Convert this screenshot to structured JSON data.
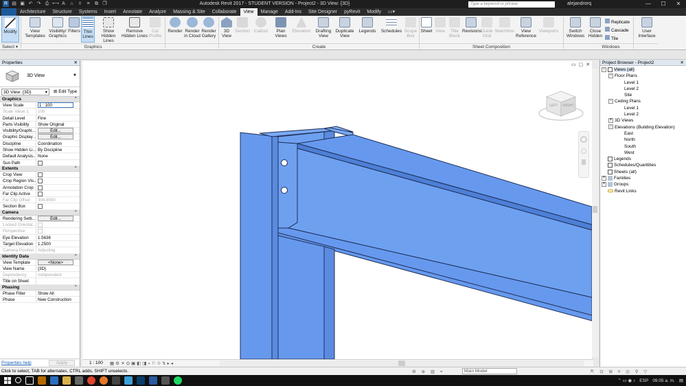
{
  "titlebar": {
    "title": "Autodesk Revit 2017 - STUDENT VERSION -    Project2 - 3D View: {3D}",
    "search_placeholder": "Type a keyword or phrase",
    "user": "alejandrorq",
    "minimize": "—",
    "maximize": "☐",
    "close": "✕"
  },
  "tabs": {
    "file": "",
    "items": [
      "Architecture",
      "Structure",
      "Systems",
      "Insert",
      "Annotate",
      "Analyze",
      "Massing & Site",
      "Collaborate",
      "View",
      "Manage",
      "Add-Ins",
      "Site Designer",
      "pyRevit",
      "Modify"
    ],
    "active": "View"
  },
  "ribbon": {
    "buttons": [
      {
        "label": "Modify",
        "icon": "arrow-cursor-icon"
      },
      {
        "label": "View Templates",
        "icon": "view-templates-icon"
      },
      {
        "label": "Visibility/ Graphics",
        "icon": "visibility-graphics-icon"
      },
      {
        "label": "Filters",
        "icon": "filters-icon"
      },
      {
        "label": "Thin Lines",
        "icon": "thin-lines-icon"
      },
      {
        "label": "Show Hidden Lines",
        "icon": "show-hidden-lines-icon"
      },
      {
        "label": "Remove Hidden Lines",
        "icon": "remove-hidden-lines-icon"
      },
      {
        "label": "Cut Profile",
        "icon": "cut-profile-icon"
      },
      {
        "label": "Render",
        "icon": "render-teapot-icon"
      },
      {
        "label": "Render in Cloud",
        "icon": "render-cloud-icon"
      },
      {
        "label": "Render Gallery",
        "icon": "render-gallery-icon"
      },
      {
        "label": "3D View",
        "icon": "house-3d-icon"
      },
      {
        "label": "Section",
        "icon": "section-icon"
      },
      {
        "label": "Callout",
        "icon": "callout-icon"
      },
      {
        "label": "Plan Views",
        "icon": "plan-views-icon"
      },
      {
        "label": "Elevation",
        "icon": "elevation-icon"
      },
      {
        "label": "Drafting View",
        "icon": "drafting-view-icon"
      },
      {
        "label": "Duplicate View",
        "icon": "duplicate-view-icon"
      },
      {
        "label": "Legends",
        "icon": "legends-icon"
      },
      {
        "label": "Schedules",
        "icon": "schedules-icon"
      },
      {
        "label": "Scope Box",
        "icon": "scope-box-icon"
      },
      {
        "label": "Sheet",
        "icon": "sheet-icon"
      },
      {
        "label": "View",
        "icon": "view-on-sheet-icon"
      },
      {
        "label": "Title Block",
        "icon": "title-block-icon"
      },
      {
        "label": "Revisions",
        "icon": "revisions-icon"
      },
      {
        "label": "Guide Grid",
        "icon": "guide-grid-icon"
      },
      {
        "label": "Matchline",
        "icon": "matchline-icon"
      },
      {
        "label": "View Reference",
        "icon": "view-reference-icon"
      },
      {
        "label": "Viewports",
        "icon": "viewports-icon"
      },
      {
        "label": "Switch Windows",
        "icon": "switch-windows-icon"
      },
      {
        "label": "Close Hidden",
        "icon": "close-hidden-icon"
      },
      {
        "label": "Replicate",
        "icon": "replicate-icon"
      },
      {
        "label": "Cascade",
        "icon": "cascade-icon"
      },
      {
        "label": "Tile",
        "icon": "tile-icon"
      },
      {
        "label": "User Interface",
        "icon": "user-interface-icon"
      }
    ],
    "panels": [
      "Select ▾",
      "Graphics",
      "Create",
      "Sheet Composition",
      "Windows"
    ]
  },
  "properties": {
    "header": "Properties",
    "type_name": "3D View",
    "view_selector": "3D View: {3D}",
    "edit_type": "Edit Type",
    "groups": {
      "graphics": "Graphics",
      "extents": "Extents",
      "camera": "Camera",
      "identity": "Identity Data",
      "phasing": "Phasing"
    },
    "rows": {
      "view_scale": {
        "k": "View Scale",
        "v": "1 : 100"
      },
      "scale_value": {
        "k": "Scale Value   1:",
        "v": "100"
      },
      "detail_level": {
        "k": "Detail Level",
        "v": "Fine"
      },
      "parts_visibility": {
        "k": "Parts Visibility",
        "v": "Show Original"
      },
      "vis_graphics": {
        "k": "Visibility/Graphi...",
        "v": "Edit..."
      },
      "graphic_display": {
        "k": "Graphic Display ...",
        "v": "Edit..."
      },
      "discipline": {
        "k": "Discipline",
        "v": "Coordination"
      },
      "show_hidden": {
        "k": "Show Hidden Li...",
        "v": "By Discipline"
      },
      "default_analysis": {
        "k": "Default Analysis...",
        "v": "None"
      },
      "sun_path": {
        "k": "Sun Path",
        "v": ""
      },
      "crop_view": {
        "k": "Crop View",
        "v": ""
      },
      "crop_region": {
        "k": "Crop Region Vis...",
        "v": ""
      },
      "annotation_crop": {
        "k": "Annotation Crop",
        "v": ""
      },
      "far_clip_active": {
        "k": "Far Clip Active",
        "v": ""
      },
      "far_clip_offset": {
        "k": "Far Clip Offset",
        "v": "304.8000"
      },
      "section_box": {
        "k": "Section Box",
        "v": ""
      },
      "rendering_settings": {
        "k": "Rendering Setti...",
        "v": "Edit..."
      },
      "locked_orient": {
        "k": "Locked Orientat...",
        "v": ""
      },
      "perspective": {
        "k": "Perspective",
        "v": ""
      },
      "eye_elevation": {
        "k": "Eye Elevation",
        "v": "1.5636"
      },
      "target_elevation": {
        "k": "Target Elevation",
        "v": "1.2500"
      },
      "camera_position": {
        "k": "Camera Position",
        "v": "Adjusting"
      },
      "view_template": {
        "k": "View Template",
        "v": "<None>"
      },
      "view_name": {
        "k": "View Name",
        "v": "{3D}"
      },
      "dependency": {
        "k": "Dependency",
        "v": "Independent"
      },
      "title_on_sheet": {
        "k": "Title on Sheet",
        "v": ""
      },
      "phase_filter": {
        "k": "Phase Filter",
        "v": "Show All"
      },
      "phase": {
        "k": "Phase",
        "v": "New Construction"
      }
    },
    "help": "Properties help",
    "apply": "Apply"
  },
  "viewport": {
    "scale": "1 : 100",
    "viewcube_left": "LEFT",
    "viewcube_right": "RIGHT",
    "beam_color": "#6699ee"
  },
  "browser": {
    "header": "Project Browser - Project2",
    "tree": {
      "views": "Views (all)",
      "floor_plans": "Floor Plans",
      "level1": "Level 1",
      "level2": "Level 2",
      "site": "Site",
      "ceiling_plans": "Ceiling Plans",
      "c_level1": "Level 1",
      "c_level2": "Level 2",
      "views3d": "3D Views",
      "elevations": "Elevations (Building Elevation)",
      "east": "East",
      "north": "North",
      "south": "South",
      "west": "West",
      "legends": "Legends",
      "schedules": "Schedules/Quantities",
      "sheets": "Sheets (all)",
      "families": "Families",
      "groups": "Groups",
      "revit_links": "Revit Links"
    }
  },
  "status": {
    "message": "Click to select, TAB for alternates, CTRL adds, SHIFT unselects.",
    "workset": "Main Model"
  },
  "taskbar": {
    "lang": "ESP",
    "time": "09:05 a. m."
  }
}
